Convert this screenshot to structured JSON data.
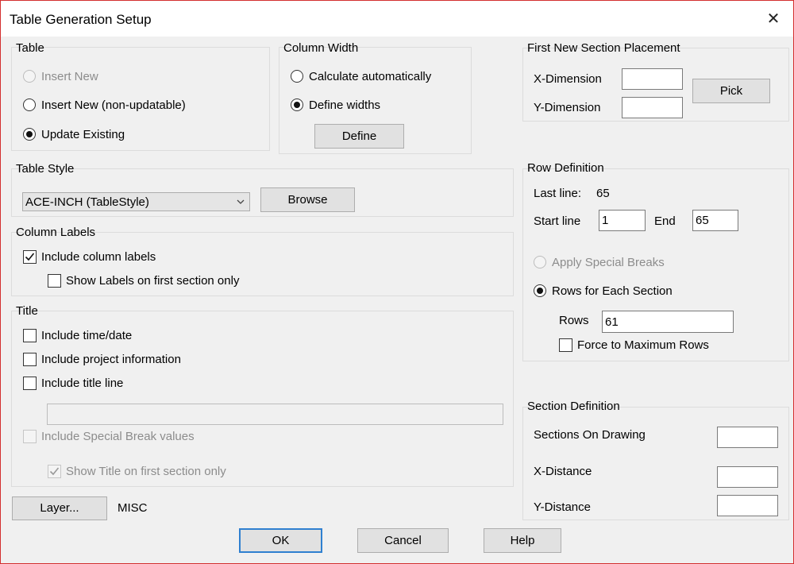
{
  "window": {
    "title": "Table Generation Setup",
    "close_icon": "close-icon"
  },
  "table_group": {
    "label": "Table",
    "insert_new": "Insert New",
    "insert_new_nonupdatable": "Insert New (non-updatable)",
    "update_existing": "Update Existing",
    "selected": "Update Existing"
  },
  "column_width": {
    "label": "Column Width",
    "calc_auto": "Calculate automatically",
    "define_widths": "Define widths",
    "selected": "Define widths",
    "define_button": "Define"
  },
  "placement": {
    "label": "First New Section Placement",
    "x_label": "X-Dimension",
    "y_label": "Y-Dimension",
    "x_value": "",
    "y_value": "",
    "pick_button": "Pick"
  },
  "table_style": {
    "label": "Table Style",
    "selected": "ACE-INCH  (TableStyle)",
    "browse_button": "Browse"
  },
  "column_labels": {
    "label": "Column Labels",
    "include": "Include column labels",
    "include_checked": true,
    "first_only": "Show Labels on first section only",
    "first_only_checked": false
  },
  "title_group": {
    "label": "Title",
    "time_date": "Include time/date",
    "project_info": "Include project information",
    "title_line": "Include title line",
    "title_line_value": "",
    "special_break": "Include Special Break values",
    "first_only": "Show Title on first section only",
    "first_only_checked": true
  },
  "row_definition": {
    "label": "Row Definition",
    "last_line_label": "Last line:",
    "last_line_value": "65",
    "start_label": "Start line",
    "start_value": "1",
    "end_label": "End",
    "end_value": "65",
    "apply_special": "Apply Special Breaks",
    "rows_each": "Rows for Each Section",
    "selected": "Rows for Each Section",
    "rows_label": "Rows",
    "rows_value": "61",
    "force_max": "Force to Maximum Rows",
    "force_max_checked": false
  },
  "section_definition": {
    "label": "Section Definition",
    "sections_on_drawing": "Sections On Drawing",
    "x_distance": "X-Distance",
    "y_distance": "Y-Distance",
    "sections_value": "",
    "x_value": "",
    "y_value": ""
  },
  "layer": {
    "button": "Layer...",
    "value": "MISC"
  },
  "footer": {
    "ok": "OK",
    "cancel": "Cancel",
    "help": "Help"
  }
}
